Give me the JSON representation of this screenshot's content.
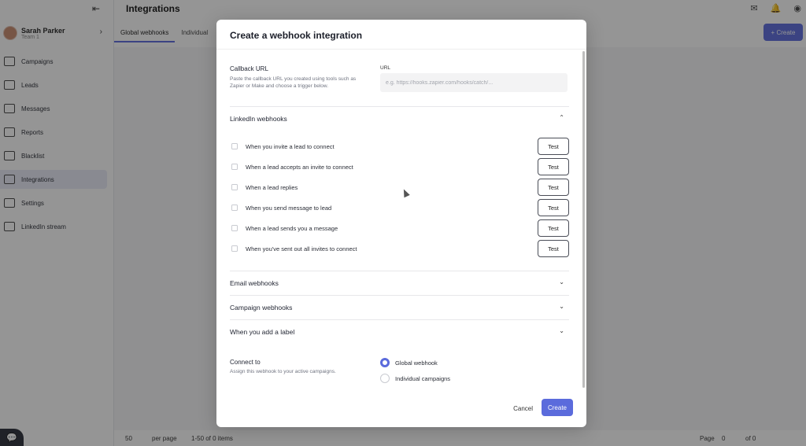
{
  "app": {
    "page_title": "Integrations",
    "user": {
      "name": "Sarah Parker",
      "team": "Team 1"
    },
    "nav": [
      "Campaigns",
      "Leads",
      "Messages",
      "Reports",
      "Blacklist",
      "Integrations",
      "Settings",
      "LinkedIn stream"
    ],
    "tabs": [
      "Global webhooks",
      "Individual"
    ],
    "create_label": "Create",
    "pager": {
      "page_size": "50",
      "per_page": "per page",
      "range": "1-50 of 0 items",
      "page_label": "Page",
      "page": "0",
      "of": "of 0"
    }
  },
  "modal": {
    "title": "Create a webhook integration",
    "callback": {
      "label": "Callback URL",
      "description": "Paste the callback URL you created using tools such as Zapier or Make and choose a trigger below.",
      "url_label": "URL",
      "url_placeholder": "e.g. https://hooks.zapier.com/hooks/catch/..."
    },
    "linkedin": {
      "title": "LinkedIn webhooks",
      "rows": [
        {
          "label": "When you invite a lead to connect",
          "button": "Test"
        },
        {
          "label": "When a lead accepts an invite to connect",
          "button": "Test"
        },
        {
          "label": "When a lead replies",
          "button": "Test"
        },
        {
          "label": "When you send message to lead",
          "button": "Test"
        },
        {
          "label": "When a lead sends you a message",
          "button": "Test"
        },
        {
          "label": "When you've sent out all invites to connect",
          "button": "Test"
        }
      ]
    },
    "email_title": "Email webhooks",
    "campaign_title": "Campaign webhooks",
    "label_title": "When you add a label",
    "connect": {
      "label": "Connect to",
      "description": "Assign this webhook to your active campaigns.",
      "options": [
        {
          "label": "Global webhook",
          "selected": true
        },
        {
          "label": "Individual campaigns",
          "selected": false
        }
      ]
    },
    "cancel": "Cancel",
    "create": "Create"
  },
  "colors": {
    "accent": "#5b6bdc"
  }
}
